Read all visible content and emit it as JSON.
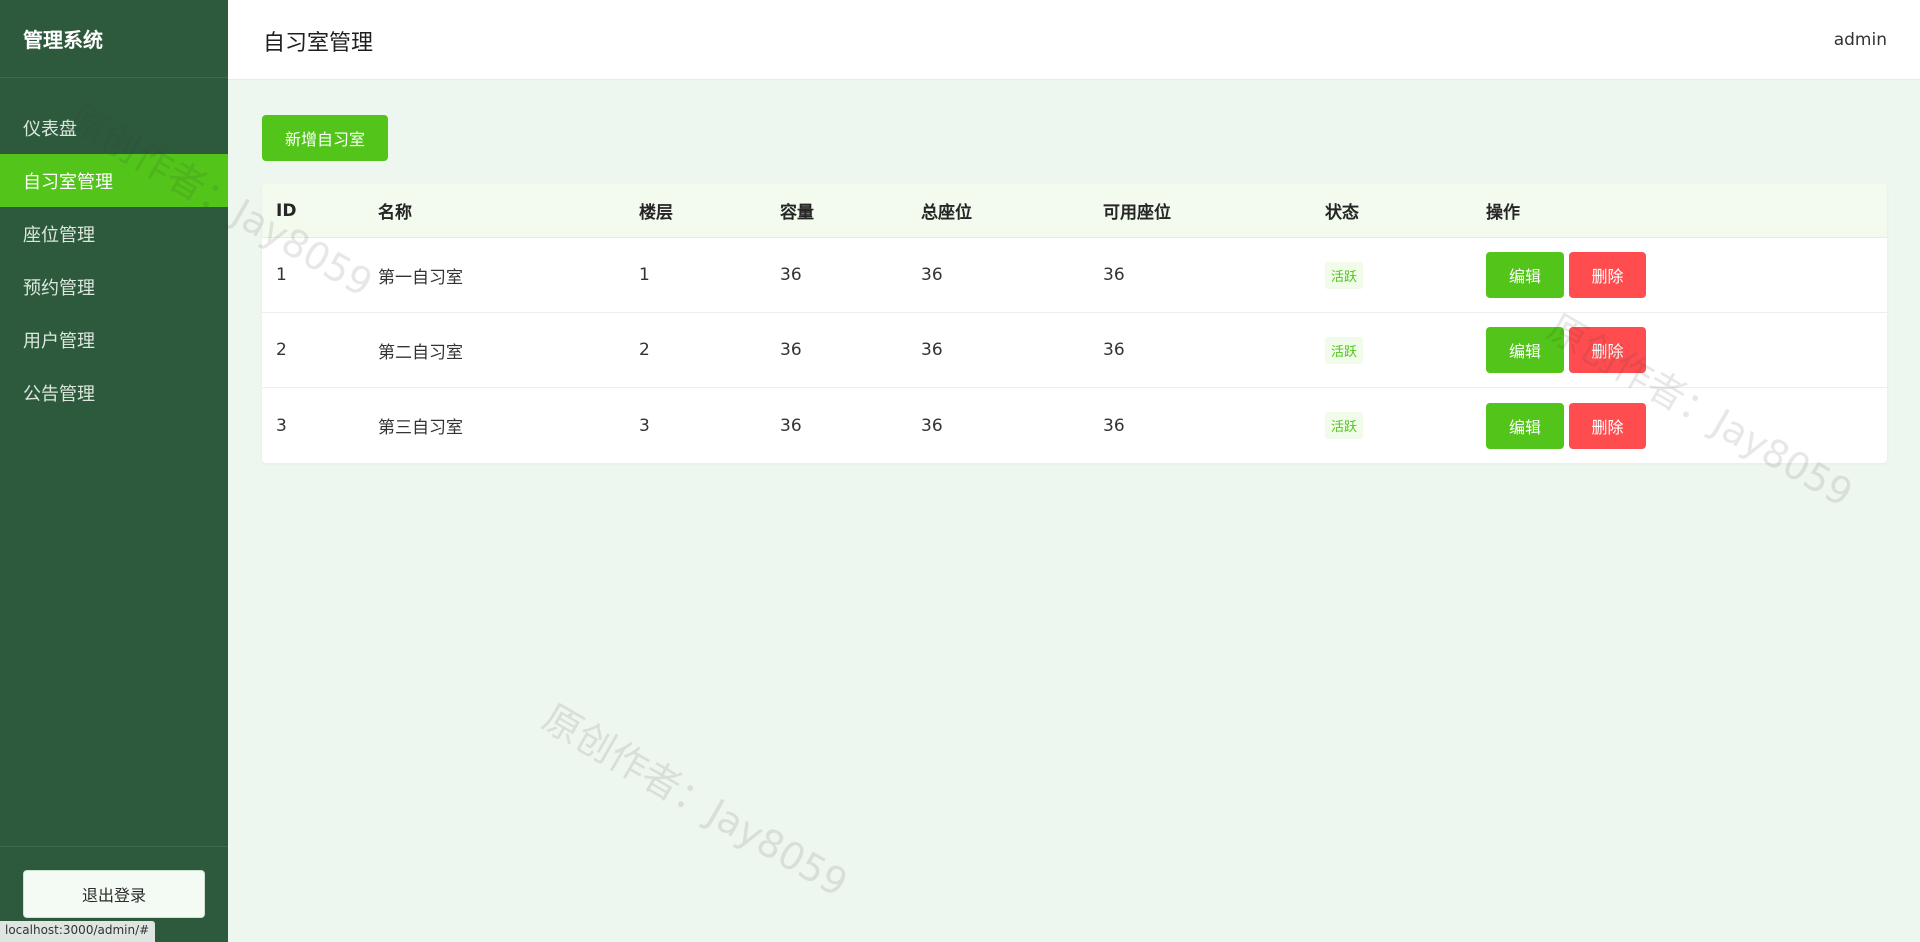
{
  "sidebar": {
    "brand": "管理系统",
    "items": [
      {
        "label": "仪表盘"
      },
      {
        "label": "自习室管理"
      },
      {
        "label": "座位管理"
      },
      {
        "label": "预约管理"
      },
      {
        "label": "用户管理"
      },
      {
        "label": "公告管理"
      }
    ],
    "active_index": 1,
    "logout_label": "退出登录"
  },
  "header": {
    "title": "自习室管理",
    "user": "admin"
  },
  "main": {
    "add_label": "新增自习室",
    "columns": [
      "ID",
      "名称",
      "楼层",
      "容量",
      "总座位",
      "可用座位",
      "状态",
      "操作"
    ],
    "rows": [
      {
        "id": "1",
        "name": "第一自习室",
        "floor": "1",
        "capacity": "36",
        "total": "36",
        "available": "36",
        "status": "活跃"
      },
      {
        "id": "2",
        "name": "第二自习室",
        "floor": "2",
        "capacity": "36",
        "total": "36",
        "available": "36",
        "status": "活跃"
      },
      {
        "id": "3",
        "name": "第三自习室",
        "floor": "3",
        "capacity": "36",
        "total": "36",
        "available": "36",
        "status": "活跃"
      }
    ],
    "edit_label": "编辑",
    "delete_label": "删除"
  },
  "watermark": "原创作者：Jay8059",
  "status_url": "localhost:3000/admin/#",
  "colors": {
    "sidebar_bg": "#2d5a3c",
    "accent": "#52c41a",
    "danger": "#ff4d4f",
    "page_bg": "#eef6f0"
  }
}
